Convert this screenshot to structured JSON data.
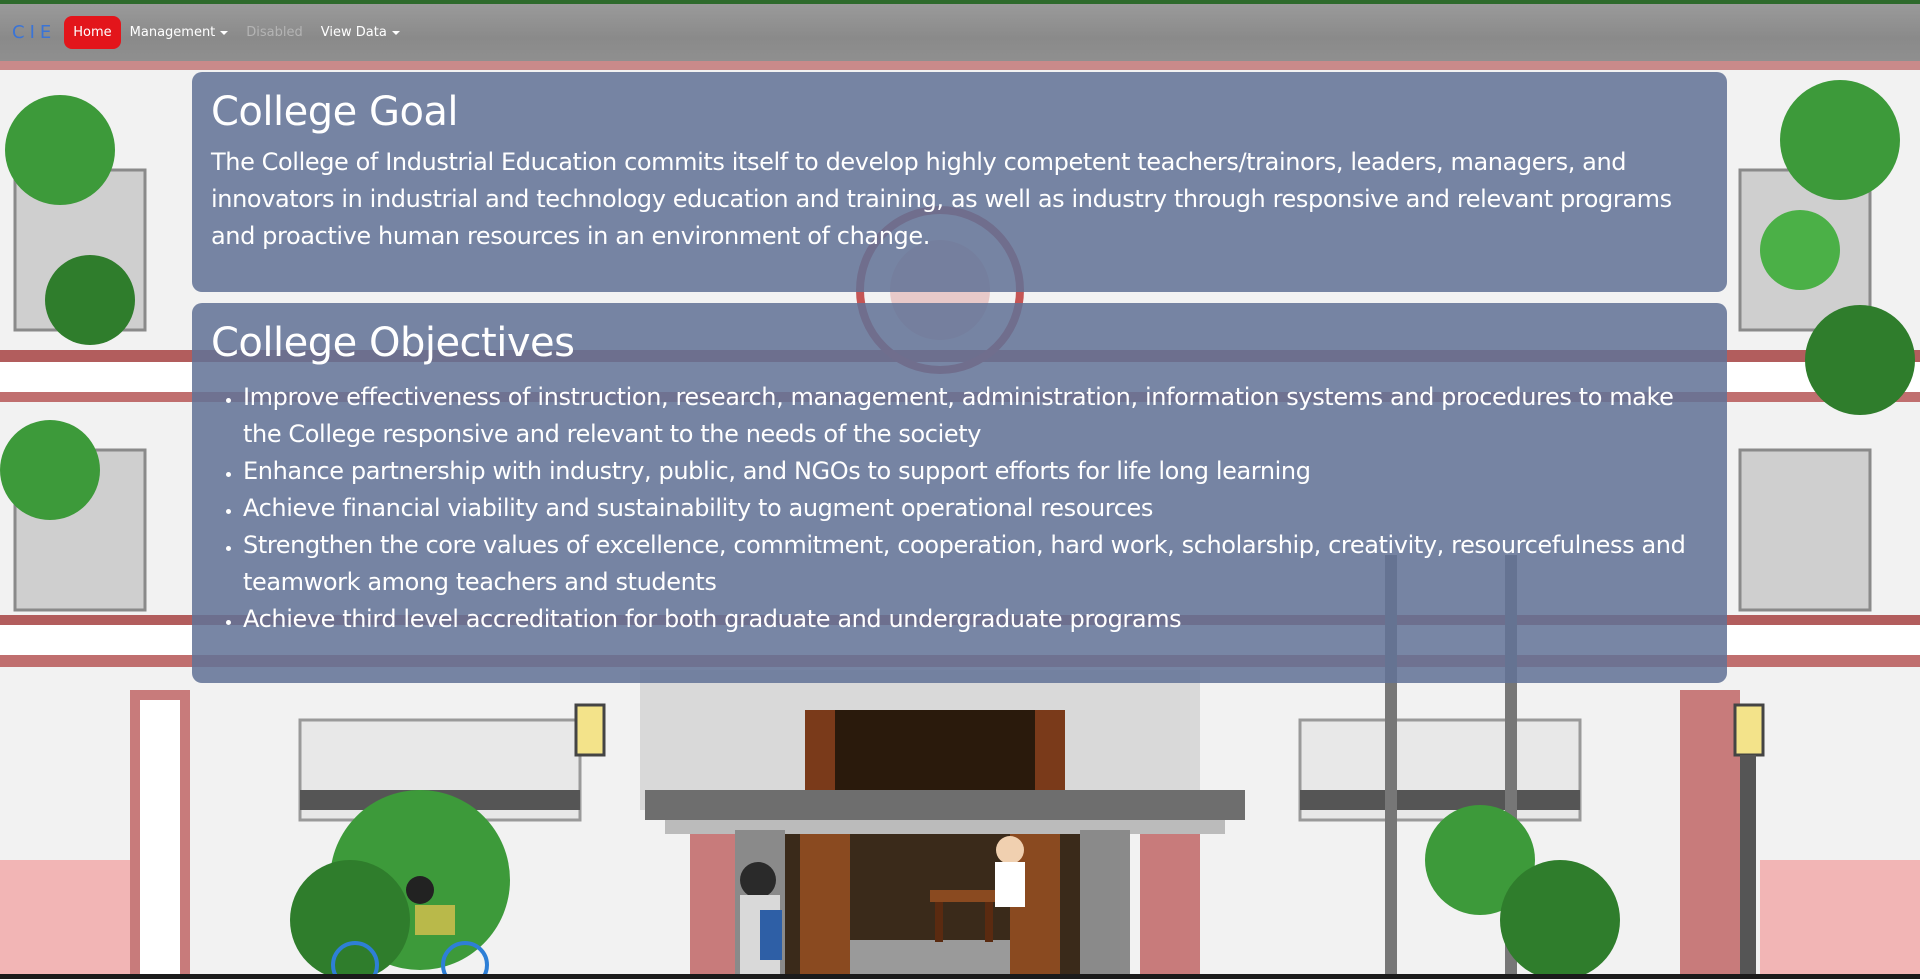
{
  "navbar": {
    "brand": "CIE",
    "items": [
      {
        "label": "Home",
        "state": "active"
      },
      {
        "label": "Management",
        "dropdown": true
      },
      {
        "label": "Disabled",
        "state": "disabled"
      },
      {
        "label": "View Data",
        "dropdown": true
      }
    ]
  },
  "goal": {
    "title": "College Goal",
    "text": "The College of Industrial Education commits itself to develop highly competent teachers/trainors, leaders, managers, and innovators in industrial and technology education and training, as well as industry through responsive and relevant programs and proactive human resources in an environment of change."
  },
  "objectives": {
    "title": "College Objectives",
    "items": [
      "Improve effectiveness of instruction, research, management, administration, information systems and procedures to make the College responsive and relevant to the needs of the society",
      "Enhance partnership with industry, public, and NGOs to support efforts for life long learning",
      "Achieve financial viability and sustainability to augment operational resources",
      "Strengthen the core values of excellence, commitment, cooperation, hard work, scholarship, creativity, resourcefulness and teamwork among teachers and students",
      "Achieve third level accreditation for both graduate and undergraduate programs"
    ]
  },
  "colors": {
    "nav_active": "#e3151b",
    "brand": "#3a74d6",
    "card_bg": "#627296",
    "top_accent": "#2e6a2c"
  },
  "icons": {
    "dropdown": "caret-down-icon",
    "bullet": "disc-bullet-icon"
  }
}
